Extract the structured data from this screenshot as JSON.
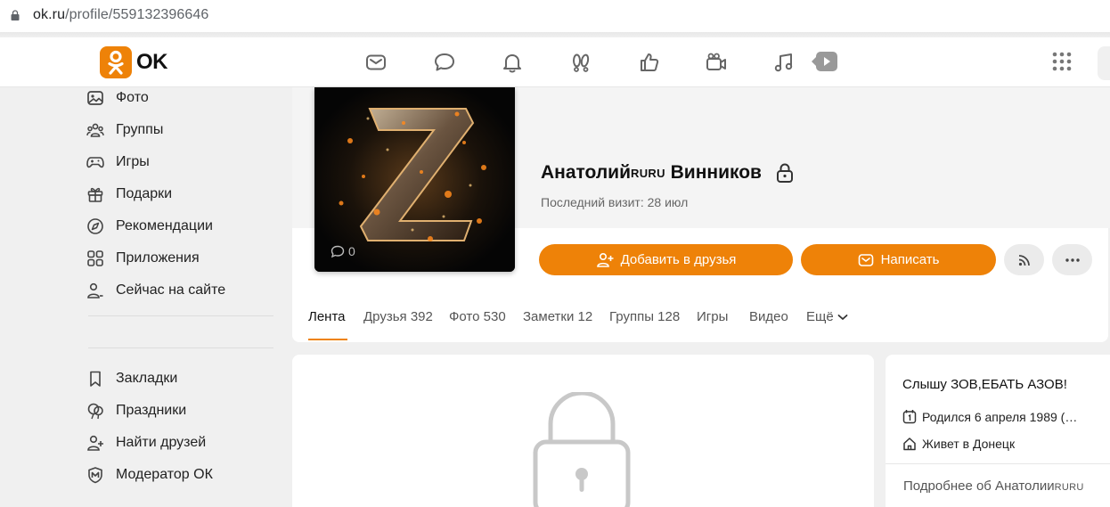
{
  "browser": {
    "url_host": "ok.ru",
    "url_path": "/profile/559132396646"
  },
  "header": {
    "logo_text": "OK",
    "nav_icons": [
      "mail-icon",
      "chat-icon",
      "bell-icon",
      "guests-icon",
      "like-icon",
      "camera-icon",
      "music-icon",
      "video-icon"
    ]
  },
  "sidebar": {
    "items": [
      {
        "label": "Фото",
        "icon": "photo-icon"
      },
      {
        "label": "Группы",
        "icon": "groups-icon"
      },
      {
        "label": "Игры",
        "icon": "gamepad-icon"
      },
      {
        "label": "Подарки",
        "icon": "gift-icon"
      },
      {
        "label": "Рекомендации",
        "icon": "compass-icon"
      },
      {
        "label": "Приложения",
        "icon": "apps-icon"
      },
      {
        "label": "Сейчас на сайте",
        "icon": "online-user-icon"
      }
    ],
    "items2": [
      {
        "label": "Закладки",
        "icon": "bookmark-icon"
      },
      {
        "label": "Праздники",
        "icon": "balloon-icon"
      },
      {
        "label": "Найти друзей",
        "icon": "add-user-icon"
      },
      {
        "label": "Модератор ОК",
        "icon": "moderator-shield-icon"
      }
    ]
  },
  "profile": {
    "name_first": "Анатолий",
    "name_suffix": "RURU",
    "name_last": "Винников",
    "last_visit": "Последний визит: 28 июл",
    "avatar_comments": "0",
    "add_friend_label": "Добавить в друзья",
    "message_label": "Написать"
  },
  "tabs": [
    {
      "label": "Лента",
      "active": true
    },
    {
      "label": "Друзья 392"
    },
    {
      "label": "Фото 530"
    },
    {
      "label": "Заметки 12"
    },
    {
      "label": "Группы 128"
    },
    {
      "label": "Игры"
    },
    {
      "label": "Видео"
    },
    {
      "label": "Ещё"
    }
  ],
  "info": {
    "status": "Слышу ЗОВ,ЕБАТЬ АЗОВ!",
    "birthday": "Родился 6 апреля 1989 (…",
    "lives": "Живет в Донецк",
    "more_prefix": "Подробнее об Анатолии",
    "more_suffix": "RURU"
  },
  "colors": {
    "accent": "#ee8208",
    "background": "#f0f0f0"
  }
}
